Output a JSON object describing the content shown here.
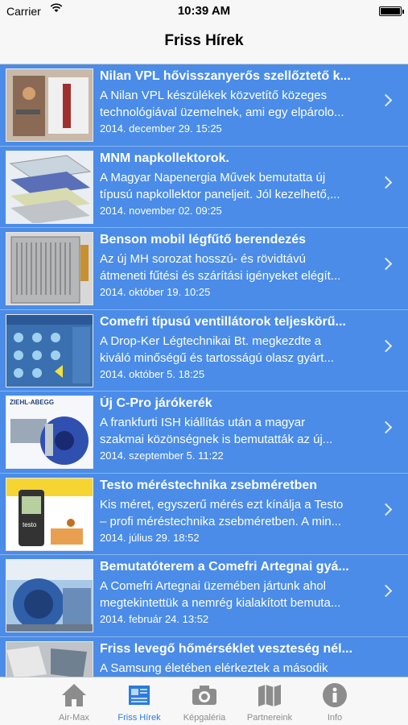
{
  "status": {
    "carrier": "Carrier",
    "time": "10:39 AM"
  },
  "nav": {
    "title": "Friss Hírek"
  },
  "news": [
    {
      "title": "Nilan VPL hővisszanyerős szellőztető k...",
      "line1": "A Nilan VPL készülékek közvetítő közeges",
      "line2": "technológiával üzemelnek, ami egy elpárolo...",
      "date": "2014. december 29. 15:25",
      "thumb": "hvac-unit"
    },
    {
      "title": "MNM napkollektorok.",
      "line1": "A Magyar Napenergia Művek bemutatta új",
      "line2": "típusú napkollektor paneljeit. Jól kezelhető,...",
      "date": "2014. november 02. 09:25",
      "thumb": "solar-panel"
    },
    {
      "title": "Benson mobil légfűtő berendezés",
      "line1": "Az új MH sorozat hosszú- és rövidtávú",
      "line2": "átmeneti fűtési és szárítási igényeket elégít...",
      "date": "2014. október 19. 10:25",
      "thumb": "heater"
    },
    {
      "title": "Comefri típusú ventillátorok teljeskörű...",
      "line1": "A Drop-Ker Légtechnikai Bt. megkezdte a",
      "line2": "kiváló minőségű és tartosságú olasz gyárt...",
      "date": "2014. október 5. 18:25",
      "thumb": "fans-catalog"
    },
    {
      "title": "Új C-Pro járókerék",
      "line1": "A frankfurti ISH kiállítás után a magyar",
      "line2": "szakmai közönségnek is bemutatták az új...",
      "date": "2014. szeptember 5. 11:22",
      "thumb": "impeller"
    },
    {
      "title": "Testo méréstechnika zsebméretben",
      "line1": "Kis méret, egyszerű mérés ezt kínálja a Testo",
      "line2": "– profi méréstechnika zsebméretben. A min...",
      "date": "2014. július 29. 18:52",
      "thumb": "testo"
    },
    {
      "title": "Bemutatóterem a Comefri Artegnai gyá...",
      "line1": "A Comefri Artegnai üzemében jártunk ahol",
      "line2": "megtekintettük a nemrég kialakított bemuta...",
      "date": "2014. február 24. 13:52",
      "thumb": "showroom"
    },
    {
      "title": "Friss levegő hőmérséklet veszteség nél...",
      "line1": "A Samsung életében elérkeztek a második",
      "line2": "",
      "date": "",
      "thumb": "samsung"
    }
  ],
  "tabs": [
    {
      "label": "Air-Max",
      "icon": "home-icon",
      "active": false
    },
    {
      "label": "Friss Hírek",
      "icon": "newspaper-icon",
      "active": true
    },
    {
      "label": "Képgaléria",
      "icon": "camera-icon",
      "active": false
    },
    {
      "label": "Partnereink",
      "icon": "map-icon",
      "active": false
    },
    {
      "label": "Info",
      "icon": "info-icon",
      "active": false
    }
  ],
  "thumb_labels": {
    "ziehl": "ZIEHL-ABEGG",
    "testo": "testo"
  },
  "colors": {
    "list_bg": "#4a8ce8",
    "active_tab": "#2a7be0",
    "inactive_tab": "#8c8c8c"
  }
}
